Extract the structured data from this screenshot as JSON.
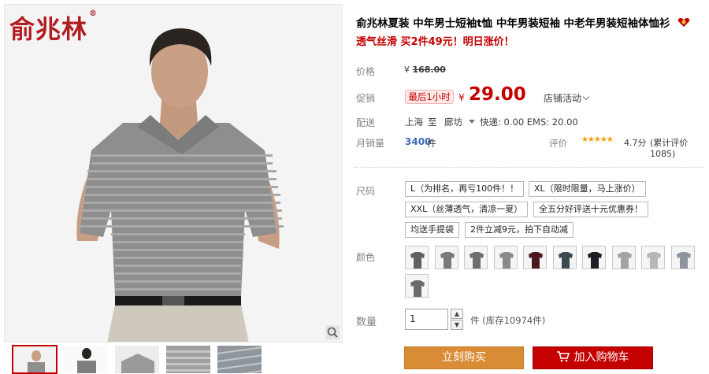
{
  "brand": {
    "logo_text": "俞兆林",
    "registered_mark": "®"
  },
  "product": {
    "title": "俞兆林夏装 中年男士短袖t恤 中年男装短袖 中老年男装短袖体恤衫",
    "subtitle": "透气丝滑 买2件49元！明日涨价！"
  },
  "labels": {
    "price": "价格",
    "promo_price": "促销",
    "delivery": "配送",
    "monthly_sales": "月销量",
    "rating": "评价",
    "size": "尺码",
    "color": "颜色",
    "quantity": "数量"
  },
  "price": {
    "currency": "¥",
    "original": "168.00",
    "limited_tag": "最后1小时",
    "current": "29.00",
    "store_promo": "店铺活动"
  },
  "shipping": {
    "from": "上海",
    "to_word": "至",
    "destination": "廊坊",
    "fees": "快递: 0.00 EMS: 20.00"
  },
  "sales": {
    "count": "3400",
    "unit": "件"
  },
  "rating": {
    "score": "4.7分",
    "review_link": "(累计评价1085)",
    "stars": 4.7
  },
  "sizes": [
    "L（为排名，再亏100件！！",
    "XL（限时限量，马上涨价）",
    "XXL（丝薄透气，清凉一夏）",
    "全五分好评送十元优惠券！",
    "均送手提袋",
    "2件立减9元，拍下自动减"
  ],
  "colors": [
    "#5f6060",
    "#7a7a7a",
    "#6d6d6d",
    "#8a8a8a",
    "#4a1a1f",
    "#3e4a52",
    "#1b1f24",
    "#a3a3a3",
    "#b7b7b7",
    "#8d949c",
    "#6a6a6a"
  ],
  "quantity": {
    "value": "1",
    "stock_text": "件 (库存10974件)"
  },
  "actions": {
    "buy_now": "立刻购买",
    "add_to_cart": "加入购物车"
  }
}
